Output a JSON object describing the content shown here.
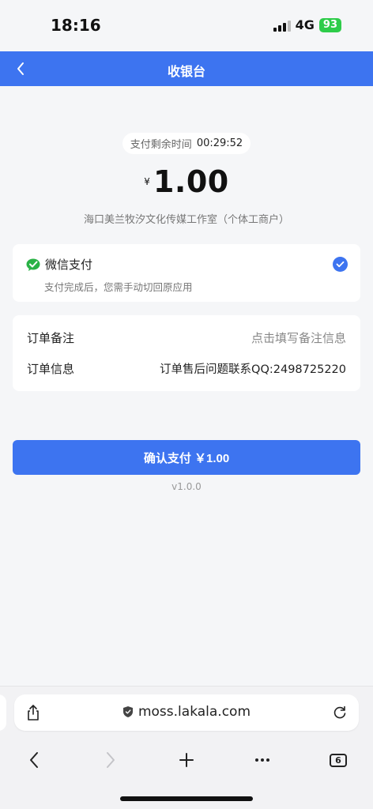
{
  "status_bar": {
    "time": "18:16",
    "network": "4G",
    "battery": "93"
  },
  "nav": {
    "title": "收银台",
    "back_icon": "chevron-left-icon"
  },
  "timer": {
    "label": "支付剩余时间",
    "value": "00:29:52"
  },
  "amount": {
    "currency": "¥",
    "value": "1.00"
  },
  "merchant": "海口美兰牧汐文化传媒工作室（个体工商户）",
  "payment_method": {
    "icon": "wechat-pay-icon",
    "label": "微信支付",
    "note": "支付完成后，您需手动切回原应用",
    "selected": true
  },
  "order": {
    "remark_label": "订单备注",
    "remark_placeholder": "点击填写备注信息",
    "info_label": "订单信息",
    "info_value": "订单售后问题联系QQ:2498725220"
  },
  "confirm_button": "确认支付 ￥1.00",
  "version": "v1.0.0",
  "browser": {
    "url": "moss.lakala.com",
    "tab_count": "6"
  },
  "colors": {
    "primary": "#3d74f0",
    "wechat_green": "#2ab246",
    "battery_green": "#2ecc4a"
  }
}
